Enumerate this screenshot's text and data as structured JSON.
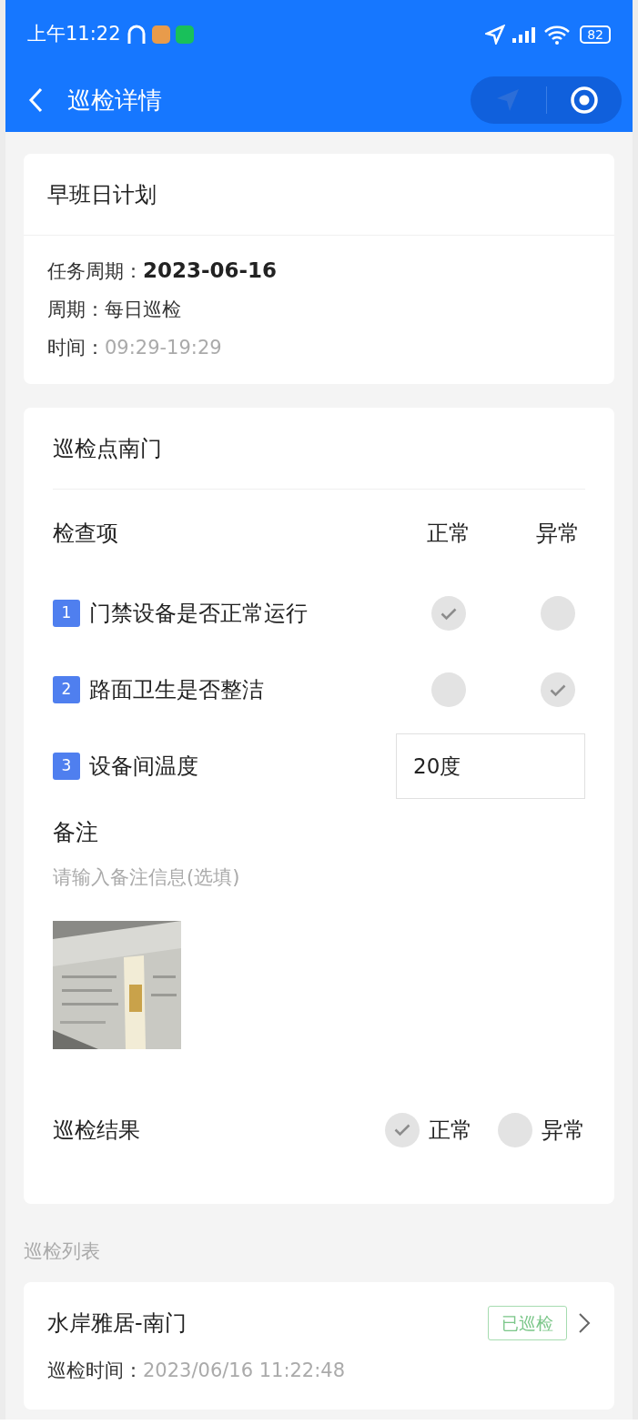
{
  "status_bar": {
    "time": "上午11:22",
    "battery": "82"
  },
  "nav": {
    "title": "巡检详情"
  },
  "plan": {
    "title": "早班日计划",
    "fields": [
      {
        "label": "任务周期：",
        "value": "2023-06-16",
        "kind": "bold"
      },
      {
        "label": "周期：",
        "value": "每日巡检",
        "kind": "plain"
      },
      {
        "label": "时间：",
        "value": "09:29-19:29",
        "kind": "muted"
      }
    ]
  },
  "point": {
    "title": "巡检点南门",
    "columns": [
      "检查项",
      "正常",
      "异常"
    ],
    "items": [
      {
        "index": "1",
        "label": "门禁设备是否正常运行",
        "kind": "choice",
        "normal": true,
        "abnormal": false
      },
      {
        "index": "2",
        "label": "路面卫生是否整洁",
        "kind": "choice",
        "normal": false,
        "abnormal": true
      },
      {
        "index": "3",
        "label": "设备间温度",
        "kind": "input",
        "value": "20度"
      }
    ],
    "remark": {
      "label": "备注",
      "placeholder": "请输入备注信息(选填)"
    },
    "result": {
      "label": "巡检结果",
      "options": [
        {
          "label": "正常",
          "selected": true
        },
        {
          "label": "异常",
          "selected": false
        }
      ]
    }
  },
  "list": {
    "title": "巡检列表",
    "items": [
      {
        "name": "水岸雅居-南门",
        "status": "已巡检",
        "time_label": "巡检时间：",
        "time": "2023/06/16 11:22:48"
      }
    ]
  }
}
